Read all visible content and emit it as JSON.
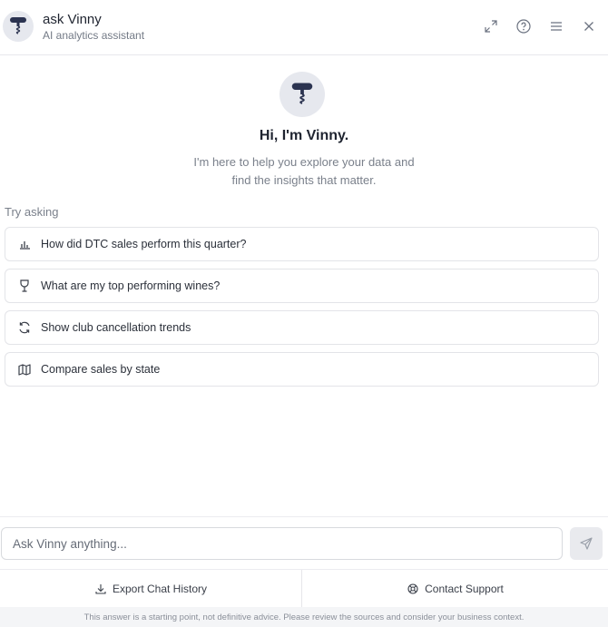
{
  "header": {
    "title": "ask Vinny",
    "subtitle": "AI analytics assistant",
    "buttons": [
      {
        "icon": "expand-icon"
      },
      {
        "icon": "help-icon"
      },
      {
        "icon": "menu-icon"
      },
      {
        "icon": "close-icon"
      }
    ]
  },
  "welcome": {
    "greeting": "Hi, I'm Vinny.",
    "intro_line1": "I'm here to help you explore your data and",
    "intro_line2": "find the insights that matter."
  },
  "suggestions": {
    "label": "Try asking",
    "items": [
      {
        "icon": "bar-chart-icon",
        "text": "How did DTC sales perform this quarter?"
      },
      {
        "icon": "wine-glass-icon",
        "text": "What are my top performing wines?"
      },
      {
        "icon": "refresh-icon",
        "text": "Show club cancellation trends"
      },
      {
        "icon": "map-icon",
        "text": "Compare sales by state"
      }
    ]
  },
  "composer": {
    "placeholder": "Ask Vinny anything...",
    "send_icon": "send-icon"
  },
  "footer": {
    "export_label": "Export Chat History",
    "support_label": "Contact Support",
    "disclaimer": "This answer is a starting point, not definitive advice. Please review the sources and consider your business context."
  },
  "colors": {
    "accent": "#2b3350",
    "border": "#e3e4e8",
    "muted_text": "#7a808b"
  }
}
